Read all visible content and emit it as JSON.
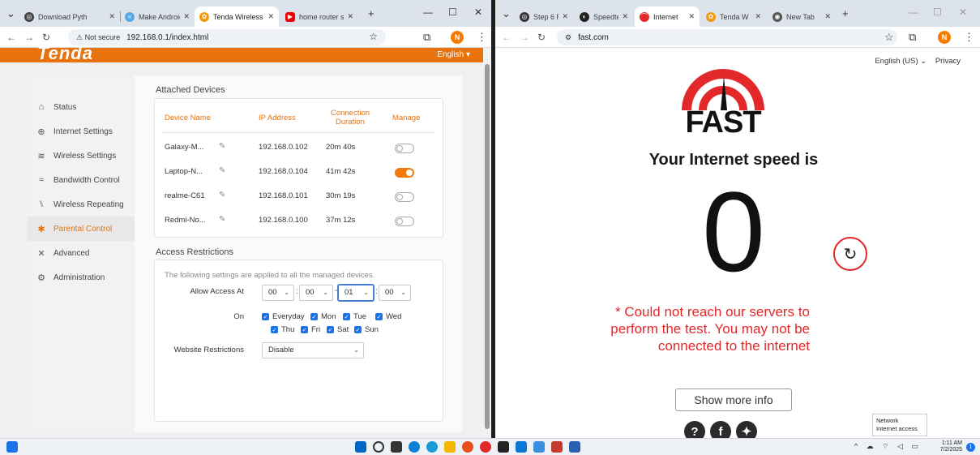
{
  "left_browser": {
    "tabs": [
      {
        "label": "Download Pyth",
        "active": false
      },
      {
        "label": "Make Android",
        "active": false
      },
      {
        "label": "Tenda Wireless",
        "active": true
      },
      {
        "label": "home router s",
        "active": false
      }
    ],
    "not_secure": "Not secure",
    "url": "192.168.0.1/index.html"
  },
  "right_browser": {
    "tabs": [
      {
        "label": "Step 6 R",
        "active": false
      },
      {
        "label": "Speedte",
        "active": false
      },
      {
        "label": "Internet",
        "active": true
      },
      {
        "label": "Tenda W",
        "active": false
      },
      {
        "label": "New Tab",
        "active": false
      }
    ],
    "url": "fast.com"
  },
  "profile_initial": "N",
  "tenda": {
    "logo": "Tenda",
    "language": "English",
    "nav": [
      {
        "label": "Status",
        "icon": "router-icon",
        "active": false
      },
      {
        "label": "Internet Settings",
        "icon": "globe-icon",
        "active": false
      },
      {
        "label": "Wireless Settings",
        "icon": "wifi-icon",
        "active": false
      },
      {
        "label": "Bandwidth Control",
        "icon": "bandwidth-icon",
        "active": false
      },
      {
        "label": "Wireless Repeating",
        "icon": "repeater-icon",
        "active": false
      },
      {
        "label": "Parental Control",
        "icon": "family-icon",
        "active": true
      },
      {
        "label": "Advanced",
        "icon": "tools-icon",
        "active": false
      },
      {
        "label": "Administration",
        "icon": "gears-icon",
        "active": false
      }
    ],
    "attached": {
      "title": "Attached Devices",
      "headers": {
        "device": "Device Name",
        "ip": "IP Address",
        "duration": "Connection Duration",
        "manage": "Manage"
      },
      "rows": [
        {
          "name": "Galaxy-M...",
          "ip": "192.168.0.102",
          "duration": "20m 40s",
          "manage": false
        },
        {
          "name": "Laptop-N...",
          "ip": "192.168.0.104",
          "duration": "41m 42s",
          "manage": true
        },
        {
          "name": "realme-C61",
          "ip": "192.168.0.101",
          "duration": "30m 19s",
          "manage": false
        },
        {
          "name": "Redmi-No...",
          "ip": "192.168.0.100",
          "duration": "37m 12s",
          "manage": false
        }
      ]
    },
    "access": {
      "title": "Access Restrictions",
      "note": "The following settings are applied to all the managed devices.",
      "allow_label": "Allow Access At",
      "times": [
        "00",
        "00",
        "01",
        "00"
      ],
      "on_label": "On",
      "days": [
        "Everyday",
        "Mon",
        "Tue",
        "Wed",
        "Thu",
        "Fri",
        "Sat",
        "Sun"
      ],
      "website_label": "Website Restrictions",
      "website_value": "Disable"
    }
  },
  "fast": {
    "language": "English (US)",
    "privacy": "Privacy",
    "logo_word": "FAST",
    "heading": "Your Internet speed is",
    "speed": "0",
    "error_line1": "* Could not reach our servers to",
    "error_line2": "perform the test. You may not be",
    "error_line3": "connected to the internet",
    "more_info": "Show more info",
    "tooltip_line1": "Network",
    "tooltip_line2": "Internet access"
  },
  "taskbar": {
    "time": "1:11 AM",
    "date": "7/2/2025"
  },
  "colors": {
    "tenda_orange": "#e8720c",
    "fast_red": "#e3282a"
  }
}
